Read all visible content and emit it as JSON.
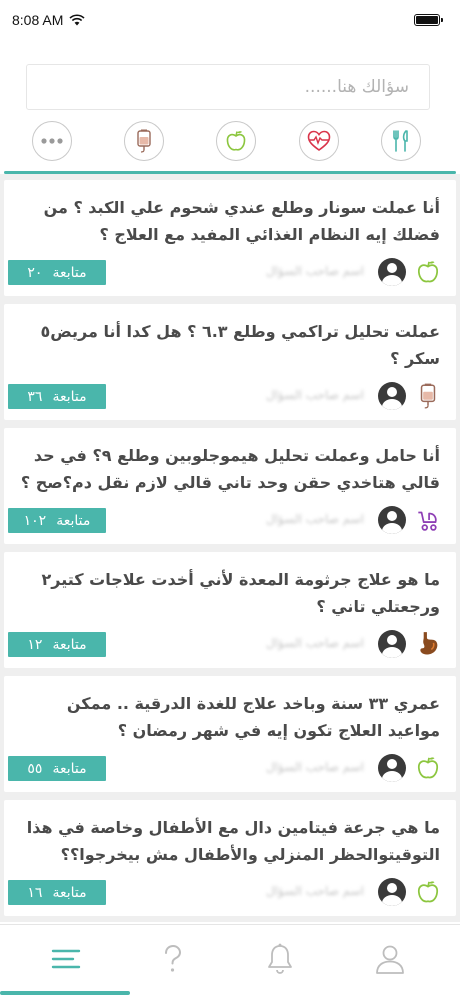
{
  "status_bar": {
    "time": "8:08 AM"
  },
  "search": {
    "placeholder": "سؤالك هنا......"
  },
  "categories": [
    {
      "icon": "more-icon"
    },
    {
      "icon": "blood-bag-icon"
    },
    {
      "icon": "apple-icon"
    },
    {
      "icon": "heart-pulse-icon"
    },
    {
      "icon": "fork-knife-icon"
    }
  ],
  "colors": {
    "accent": "#4ab6ab",
    "apple": "#8cc63f",
    "heart": "#d9344a",
    "pregnancy": "#8e3fb5",
    "stomach": "#8a4b1f"
  },
  "questions": [
    {
      "text": "أنا عملت سونار وطلع عندي شحوم علي الكبد ؟ من فضلك إيه النظام الغذائي المفيد  مع العلاج ؟",
      "follow_label": "متابعة",
      "follow_count": "٢٠",
      "author": "اسم صاحب السؤال",
      "category_icon": "apple-icon"
    },
    {
      "text": "عملت تحليل تراكمي وطلع ٦.٣ ؟ هل كدا أنا مريض٥ سكر ؟",
      "follow_label": "متابعة",
      "follow_count": "٣٦",
      "author": "اسم صاحب السؤال",
      "category_icon": "blood-bag-icon"
    },
    {
      "text": "أنا حامل وعملت تحليل هيموجلوبين وطلع ٩؟ في حد قالي هتاخدي حقن وحد تاني قالي لازم نقل دم؟صح ؟",
      "follow_label": "متابعة",
      "follow_count": "١٠٢",
      "author": "اسم صاحب السؤال",
      "category_icon": "stroller-icon"
    },
    {
      "text": "ما هو علاج جرثومة المعدة لأني أخدت علاجات كتير٢ ورجعتلي تاني ؟",
      "follow_label": "متابعة",
      "follow_count": "١٢",
      "author": "اسم صاحب السؤال",
      "category_icon": "stomach-icon"
    },
    {
      "text": "عمري ٣٣ سنة وباخد علاج للغدة الدرقية .. ممكن مواعيد العلاج تكون إيه في شهر رمضان ؟",
      "follow_label": "متابعة",
      "follow_count": "٥٥",
      "author": "اسم صاحب السؤال",
      "category_icon": "apple-icon"
    },
    {
      "text": "ما هي جرعة فيتامين دال مع الأطفال وخاصة في هذا التوقيتوالحظر المنزلي والأطفال مش بيخرجوا؟؟",
      "follow_label": "متابعة",
      "follow_count": "١٦",
      "author": "اسم صاحب السؤال",
      "category_icon": "apple-icon"
    }
  ],
  "tabs": [
    {
      "icon": "list-icon",
      "active": true
    },
    {
      "icon": "question-mark-icon",
      "active": false
    },
    {
      "icon": "bell-icon",
      "active": false
    },
    {
      "icon": "user-icon",
      "active": false
    }
  ]
}
